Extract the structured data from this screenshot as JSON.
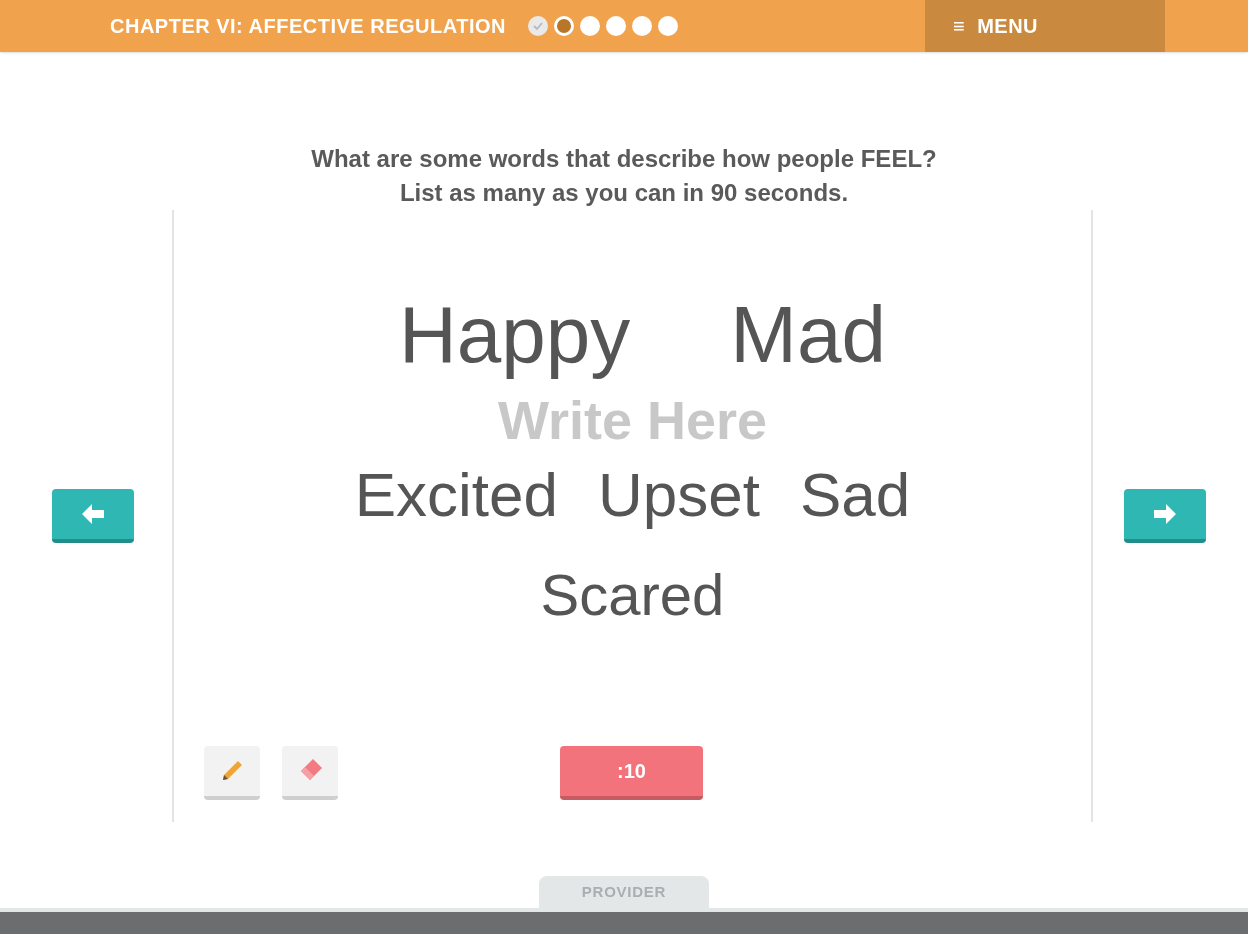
{
  "header": {
    "chapter": "CHAPTER VI: AFFECTIVE REGULATION",
    "progress": [
      {
        "done": true,
        "selected": false
      },
      {
        "done": false,
        "selected": true
      },
      {
        "done": false,
        "selected": false
      },
      {
        "done": false,
        "selected": false
      },
      {
        "done": false,
        "selected": false
      },
      {
        "done": false,
        "selected": false
      }
    ],
    "menu": {
      "icon": "≡",
      "label": "MENU"
    }
  },
  "prompt": [
    "What are some words that describe how people FEEL?",
    "List as many as you can in 90 seconds."
  ],
  "canvas": {
    "placeholder": "Write Here",
    "rows": [
      [
        "Happy",
        "Mad"
      ],
      [
        "Excited",
        "Upset",
        "Sad"
      ],
      [
        "Scared"
      ]
    ]
  },
  "tools": [
    {
      "kind": "pencil"
    },
    {
      "kind": "eraser"
    }
  ],
  "timer": ":10",
  "footer": {
    "tab": "PROVIDER"
  }
}
